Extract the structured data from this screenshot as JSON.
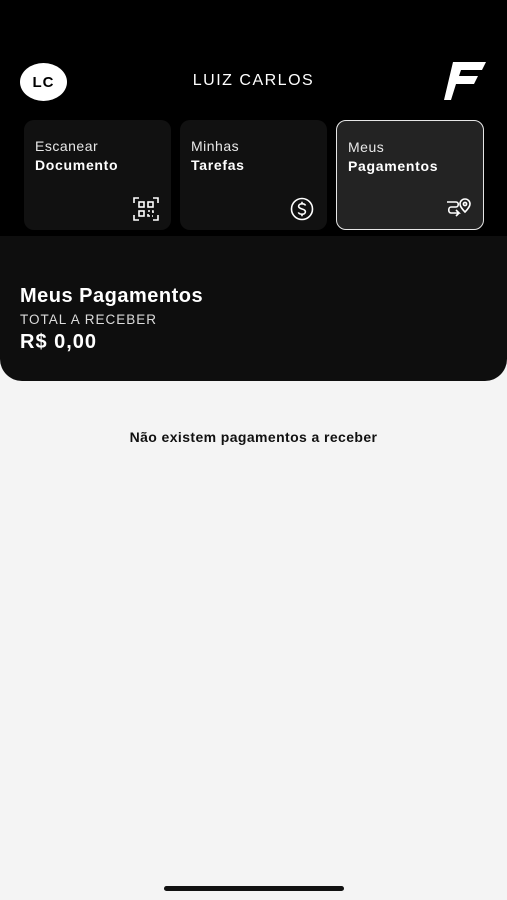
{
  "header": {
    "avatar_initials": "LC",
    "user_name": "LUIZ CARLOS",
    "logo_icon": "f-logo-icon"
  },
  "cards": [
    {
      "line1": "Escanear",
      "line2": "Documento",
      "icon": "qr-scan-icon",
      "selected": false
    },
    {
      "line1": "Minhas",
      "line2": "Tarefas",
      "icon": "dollar-circle-icon",
      "selected": false
    },
    {
      "line1": "Meus",
      "line2": "Pagamentos",
      "icon": "route-pin-icon",
      "selected": true
    }
  ],
  "payments": {
    "title": "Meus Pagamentos",
    "total_label": "TOTAL A RECEBER",
    "total_value": "R$ 0,00"
  },
  "empty_message": "Não existem pagamentos a receber",
  "colors": {
    "background": "#f4f4f4",
    "header_bg": "#000000",
    "card_bg": "#111111",
    "card_selected_bg": "#232323",
    "card_selected_border": "#e6e6e6",
    "text_light": "#ffffff"
  }
}
